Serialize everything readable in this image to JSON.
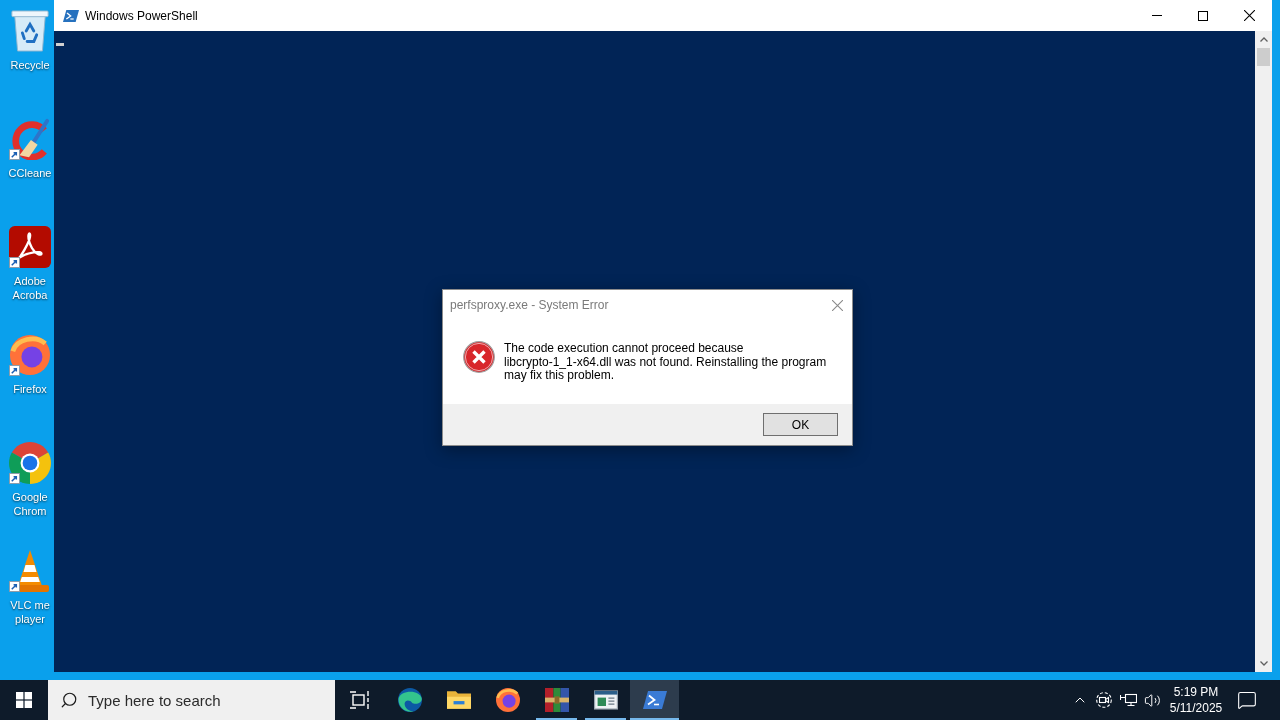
{
  "desktop": {
    "icons": [
      {
        "label": "Recycle",
        "kind": "recycle-bin",
        "shortcut": false
      },
      {
        "label": "CCleane",
        "kind": "cleaner",
        "shortcut": true
      },
      {
        "label": "Adobe Acroba",
        "kind": "pdf-reader",
        "shortcut": true
      },
      {
        "label": "Firefox",
        "kind": "firefox",
        "shortcut": true
      },
      {
        "label": "Google Chrom",
        "kind": "chrome",
        "shortcut": true
      },
      {
        "label": "VLC me player",
        "kind": "media-player",
        "shortcut": true
      }
    ]
  },
  "window": {
    "title": "Windows PowerShell"
  },
  "dialog": {
    "title": "perfsproxy.exe - System Error",
    "message": "The code execution cannot proceed because\nlibcrypto-1_1-x64.dll was not found. Reinstalling the program\nmay fix this problem.",
    "buttons": [
      "OK"
    ]
  },
  "taskbar": {
    "search": {
      "placeholder": "Type here to search"
    },
    "apps": [
      {
        "kind": "edge",
        "running": false,
        "selected": false
      },
      {
        "kind": "explorer",
        "running": false,
        "selected": false
      },
      {
        "kind": "firefox",
        "running": false,
        "selected": false
      },
      {
        "kind": "archiver",
        "running": true,
        "selected": false
      },
      {
        "kind": "window",
        "running": true,
        "selected": false
      },
      {
        "kind": "powershell",
        "running": true,
        "selected": true
      }
    ],
    "clock": {
      "time": "5:19 PM",
      "date": "5/11/2025"
    }
  }
}
